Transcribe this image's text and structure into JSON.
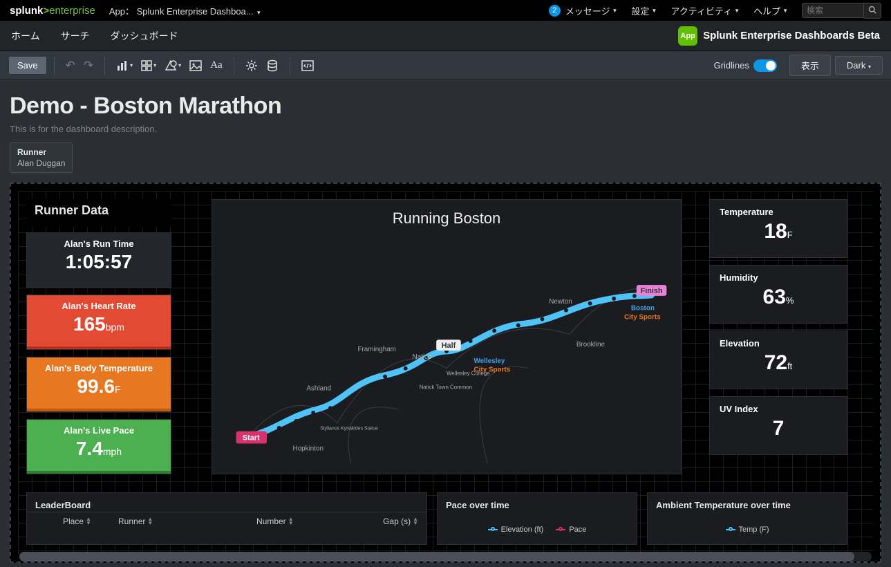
{
  "top": {
    "logo1": "splunk",
    "logo2": "enterprise",
    "app_label": "App：",
    "app_name": "Splunk Enterprise Dashboa...",
    "messages_count": "2",
    "messages": "メッセージ",
    "settings": "設定",
    "activity": "アクティビティ",
    "help": "ヘルプ",
    "search_placeholder": "検索"
  },
  "nav2": {
    "home": "ホーム",
    "search": "サーチ",
    "dashboard": "ダッシュボード",
    "app_icon": "App",
    "app_title": "Splunk Enterprise Dashboards Beta"
  },
  "toolbar": {
    "save": "Save",
    "gridlines": "Gridlines",
    "display": "表示",
    "dark": "Dark"
  },
  "page": {
    "title": "Demo - Boston Marathon",
    "desc": "This is for the dashboard description.",
    "filter_label": "Runner",
    "filter_value": "Alan Duggan"
  },
  "runner_data": {
    "title": "Runner Data",
    "runtime_label": "Alan's Run Time",
    "runtime_value": "1:05:57",
    "hr_label": "Alan's Heart Rate",
    "hr_value": "165",
    "hr_unit": "bpm",
    "bt_label": "Alan's Body Temperature",
    "bt_value": "99.6",
    "bt_unit": "F",
    "pace_label": "Alan's Live Pace",
    "pace_value": "7.4",
    "pace_unit": "mph"
  },
  "map": {
    "title": "Running Boston",
    "start": "Start",
    "half": "Half",
    "finish": "Finish",
    "hopkinton": "Hopkinton",
    "ashland": "Ashland",
    "framingham": "Framingham",
    "natick": "Natick",
    "natick_town": "Natick Town Common",
    "wellesley": "Wellesley",
    "wellesley_college": "Wellesley College",
    "city_sports": "City Sports",
    "newton": "Newton",
    "brookline": "Brookline",
    "boston": "Boston",
    "city_sports2": "City Sports",
    "stylianos": "Stylianos Kyriakides Statue"
  },
  "env": {
    "temp_label": "Temperature",
    "temp_value": "18",
    "temp_unit": "F",
    "hum_label": "Humidity",
    "hum_value": "63",
    "hum_unit": "%",
    "elev_label": "Elevation",
    "elev_value": "72",
    "elev_unit": "ft",
    "uv_label": "UV Index",
    "uv_value": "7"
  },
  "leaderboard": {
    "title": "LeaderBoard",
    "col_place": "Place",
    "col_runner": "Runner",
    "col_number": "Number",
    "col_gap": "Gap (s)"
  },
  "pace_chart": {
    "title": "Pace over time",
    "legend_elev": "Elevation (ft)",
    "legend_pace": "Pace"
  },
  "temp_chart": {
    "title": "Ambient Temperature over time",
    "legend_temp": "Temp (F)"
  }
}
